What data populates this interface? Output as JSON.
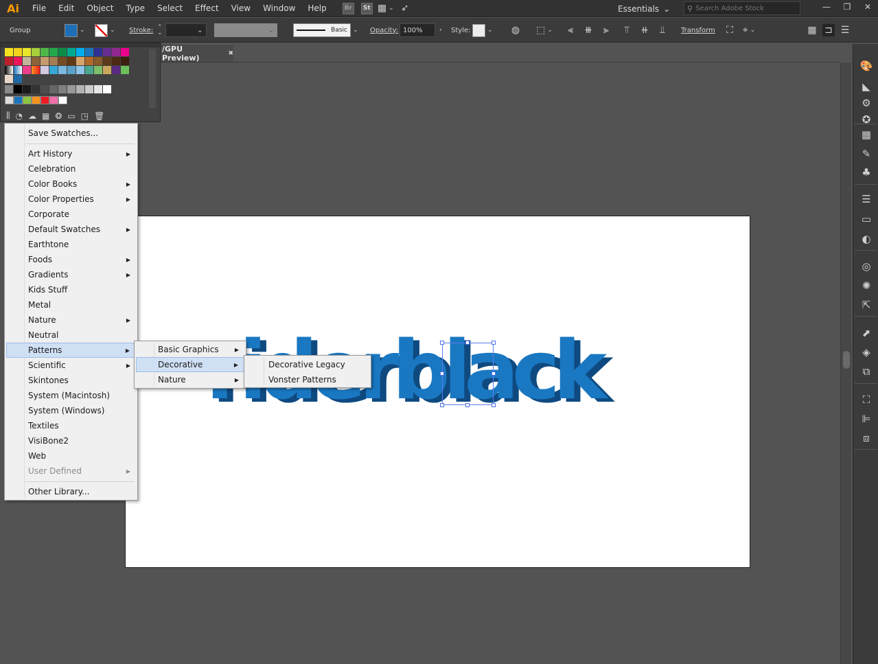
{
  "app": {
    "logo": "Ai"
  },
  "menubar": {
    "items": [
      "File",
      "Edit",
      "Object",
      "Type",
      "Select",
      "Effect",
      "View",
      "Window",
      "Help"
    ],
    "bridge": "Br",
    "stock": "St",
    "workspace": "Essentials",
    "search_placeholder": "Search Adobe Stock"
  },
  "controlbar": {
    "selection": "Group",
    "fill_color": "#1f6fb8",
    "stroke_label": "Stroke:",
    "brush": "Basic",
    "opacity_label": "Opacity:",
    "opacity_value": "100%",
    "style_label": "Style:",
    "transform_label": "Transform"
  },
  "document": {
    "tab_title": "/GPU Preview)",
    "close_glyph": "✖"
  },
  "artwork": {
    "text": "riderblack"
  },
  "library_menu": {
    "items": [
      {
        "label": "Save Swatches...",
        "submenu": false
      },
      {
        "label": "Art History",
        "submenu": true
      },
      {
        "label": "Celebration",
        "submenu": false
      },
      {
        "label": "Color Books",
        "submenu": true
      },
      {
        "label": "Color Properties",
        "submenu": true
      },
      {
        "label": "Corporate",
        "submenu": false
      },
      {
        "label": "Default Swatches",
        "submenu": true
      },
      {
        "label": "Earthtone",
        "submenu": false
      },
      {
        "label": "Foods",
        "submenu": true
      },
      {
        "label": "Gradients",
        "submenu": true
      },
      {
        "label": "Kids Stuff",
        "submenu": false
      },
      {
        "label": "Metal",
        "submenu": false
      },
      {
        "label": "Nature",
        "submenu": true
      },
      {
        "label": "Neutral",
        "submenu": false
      },
      {
        "label": "Patterns",
        "submenu": true
      },
      {
        "label": "Scientific",
        "submenu": true
      },
      {
        "label": "Skintones",
        "submenu": false
      },
      {
        "label": "System (Macintosh)",
        "submenu": false
      },
      {
        "label": "System (Windows)",
        "submenu": false
      },
      {
        "label": "Textiles",
        "submenu": false
      },
      {
        "label": "VisiBone2",
        "submenu": false
      },
      {
        "label": "Web",
        "submenu": false
      },
      {
        "label": "User Defined",
        "submenu": true,
        "disabled": true
      },
      {
        "label": "Other Library...",
        "submenu": false
      }
    ]
  },
  "patterns_menu": {
    "items": [
      {
        "label": "Basic Graphics",
        "submenu": true
      },
      {
        "label": "Decorative",
        "submenu": true
      },
      {
        "label": "Nature",
        "submenu": true
      }
    ]
  },
  "decorative_menu": {
    "items": [
      {
        "label": "Decorative Legacy"
      },
      {
        "label": "Vonster Patterns"
      }
    ]
  }
}
